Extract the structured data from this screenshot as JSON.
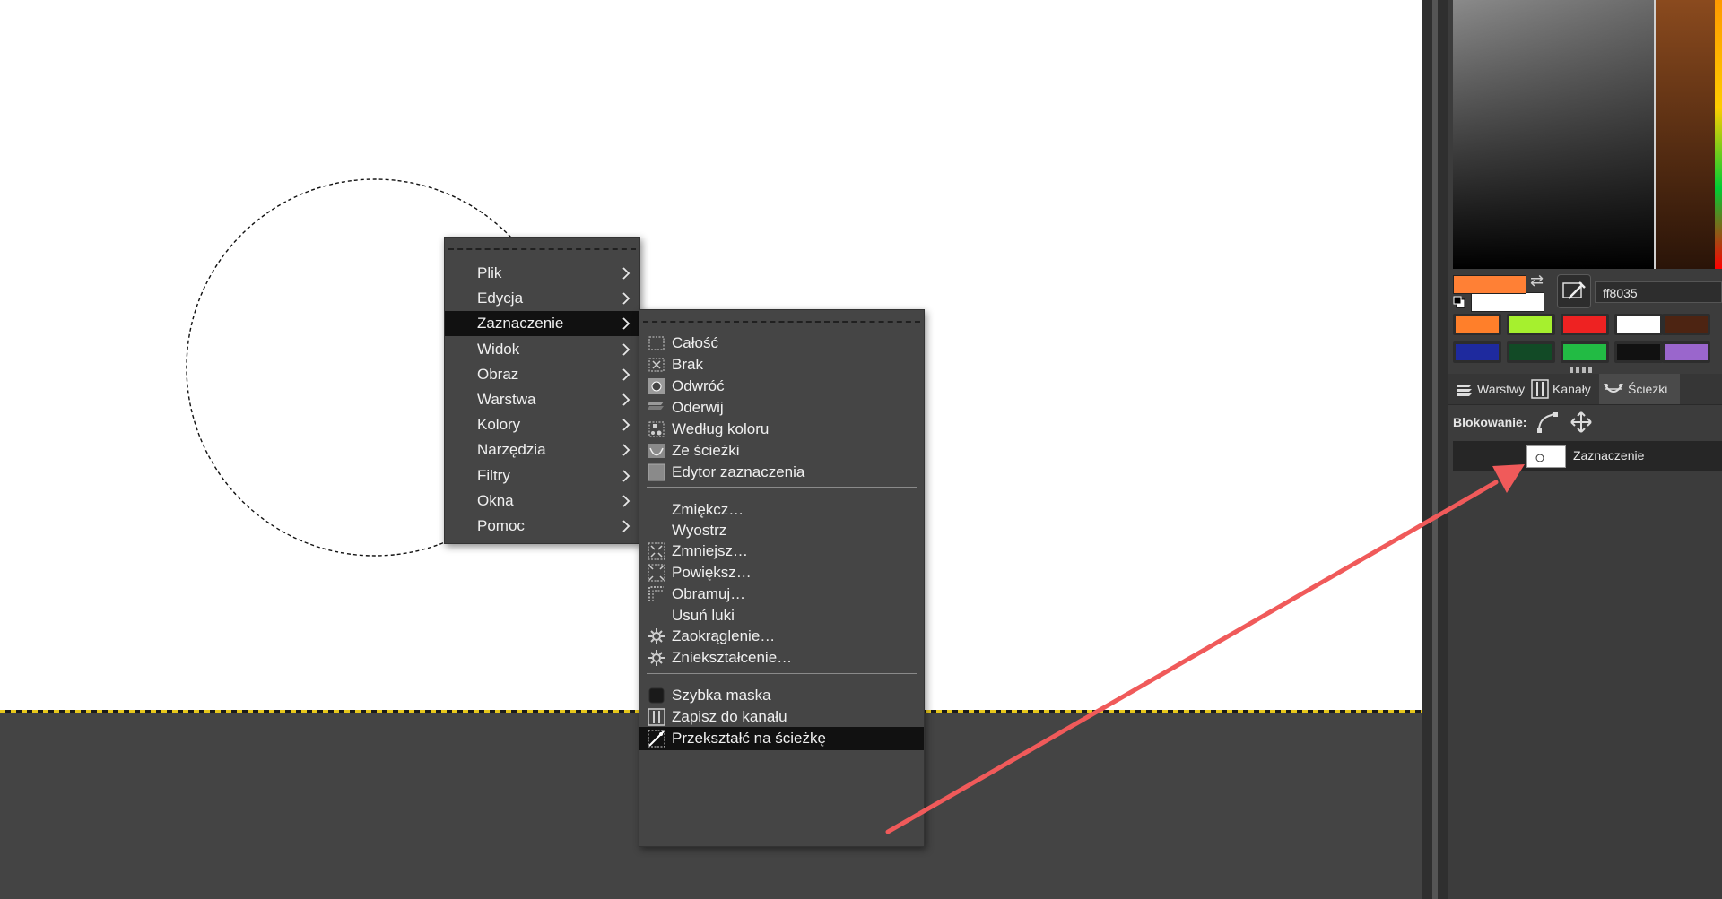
{
  "main_menu": {
    "items": [
      {
        "label": "Plik"
      },
      {
        "label": "Edycja"
      },
      {
        "label": "Zaznaczenie"
      },
      {
        "label": "Widok"
      },
      {
        "label": "Obraz"
      },
      {
        "label": "Warstwa"
      },
      {
        "label": "Kolory"
      },
      {
        "label": "Narzędzia"
      },
      {
        "label": "Filtry"
      },
      {
        "label": "Okna"
      },
      {
        "label": "Pomoc"
      }
    ],
    "highlighted": "Zaznaczenie"
  },
  "selection_menu": {
    "items": [
      {
        "label": "Całość",
        "icon": "select-all-icon"
      },
      {
        "label": "Brak",
        "icon": "select-none-icon"
      },
      {
        "label": "Odwróć",
        "icon": "invert-selection-icon"
      },
      {
        "label": "Oderwij",
        "icon": "float-icon"
      },
      {
        "label": "Według koloru",
        "icon": "by-color-icon"
      },
      {
        "label": "Ze ścieżki",
        "icon": "from-path-icon"
      },
      {
        "label": "Edytor zaznaczenia",
        "icon": "selection-editor-icon"
      },
      {
        "label": "Zmiękcz…"
      },
      {
        "label": "Wyostrz"
      },
      {
        "label": "Zmniejsz…",
        "icon": "shrink-icon"
      },
      {
        "label": "Powiększ…",
        "icon": "grow-icon"
      },
      {
        "label": "Obramuj…",
        "icon": "border-icon"
      },
      {
        "label": "Usuń luki"
      },
      {
        "label": "Zaokrąglenie…",
        "icon": "gear-icon"
      },
      {
        "label": "Zniekształcenie…",
        "icon": "gear-icon"
      },
      {
        "label": "Szybka maska",
        "icon": "quick-mask-icon"
      },
      {
        "label": "Zapisz do kanału",
        "icon": "save-channel-icon"
      },
      {
        "label": "Przekształć na ścieżkę",
        "icon": "to-path-icon"
      }
    ],
    "highlighted": "Przekształć na ścieżkę"
  },
  "color_panel": {
    "hex": "ff8035",
    "fg_color": "#ff8035",
    "bg_color": "#ffffff",
    "palette": [
      "#ff7f2a",
      "#a6f02e",
      "#ee2222",
      "#ffffff",
      "#4d2412",
      "#1e2a9e",
      "#124a26",
      "#22bb44",
      "#111111",
      "#9a66cc"
    ]
  },
  "dock_tabs": [
    {
      "label": "Warstwy"
    },
    {
      "label": "Kanały"
    },
    {
      "label": "Ścieżki"
    }
  ],
  "lock_label": "Blokowanie:",
  "paths": [
    {
      "name": "Zaznaczenie"
    }
  ],
  "annotation": {
    "color": "#f05a5a"
  }
}
